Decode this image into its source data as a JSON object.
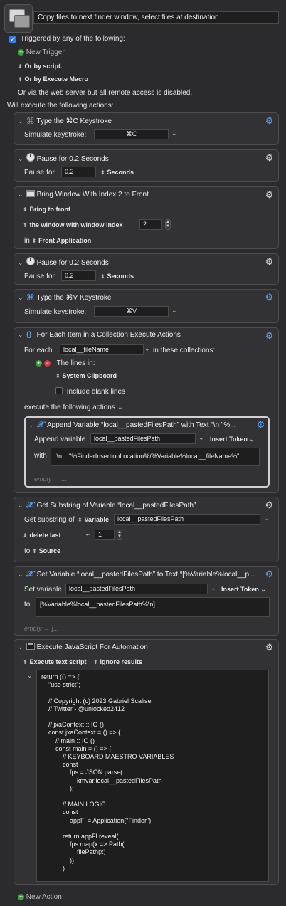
{
  "macro": {
    "name": "Copy files to next finder window, select files at destination"
  },
  "triggers": {
    "triggered_label": "Triggered by any of the following:",
    "new_trigger": "New Trigger",
    "or_by_script": "Or by script.",
    "or_by_execute_macro": "Or by Execute Macro",
    "web_server_note": "Or via the web server but all remote access is disabled.",
    "will_execute": "Will execute the following actions:"
  },
  "actions": [
    {
      "title": "Type the ⌘C Keystroke",
      "simulate_label": "Simulate keystroke:",
      "keystroke": "⌘C"
    },
    {
      "title": "Pause for 0.2 Seconds",
      "pause_label": "Pause for",
      "value": "0.2",
      "unit": "Seconds"
    },
    {
      "title": "Bring Window With Index 2 to Front",
      "mode": "Bring to front",
      "window_label": "the window with window index",
      "index": "2",
      "in_label": "in",
      "app": "Front Application"
    },
    {
      "title": "Pause for 0.2 Seconds",
      "pause_label": "Pause for",
      "value": "0.2",
      "unit": "Seconds"
    },
    {
      "title": "Type the ⌘V Keystroke",
      "simulate_label": "Simulate keystroke:",
      "keystroke": "⌘V"
    },
    {
      "title": "For Each Item in a Collection Execute Actions",
      "for_each_label": "For each",
      "variable": "local__fileName",
      "in_collections": "in these collections:",
      "lines_in": "The lines in:",
      "source": "System Clipboard",
      "include_blank": "Include blank lines",
      "execute_label": "execute the following actions",
      "sub_action": {
        "title": "Append Variable “local__pastedFilesPath” with Text “\\n    \"%...",
        "append_label": "Append variable",
        "variable": "local__pastedFilesPath",
        "insert_token": "Insert Token",
        "with_label": "with",
        "text": " \\n    \"%FinderInsertionLocation%/%Variable%local__fileName%\",",
        "empty": "empty → ..."
      }
    },
    {
      "title": "Get Substring of Variable “local__pastedFilesPath”",
      "get_label": "Get substring of",
      "var_kind": "Variable",
      "variable": "local__pastedFilesPath",
      "delete_label": "delete last",
      "arrow": "←",
      "count": "1",
      "to_label": "to",
      "dest": "Source"
    },
    {
      "title": "Set Variable “local__pastedFilesPath” to Text “[%Variable%local__p...",
      "set_label": "Set variable",
      "variable": "local__pastedFilesPath",
      "insert_token": "Insert Token",
      "to_label": "to",
      "text": "[%Variable%local__pastedFilesPath%\\n]",
      "empty": "empty → [..."
    },
    {
      "title": "Execute JavaScript For Automation",
      "mode": "Execute text script",
      "results": "Ignore results",
      "code": [
        "return (() => {",
        "    \"use strict\";",
        "",
        "    // Copyright (c) 2023 Gabriel Scalise",
        "    // Twitter - @unlocked2412",
        "",
        "    // jxaContext :: IO ()",
        "    const jxaContext = () => {",
        "        // main :: IO ()",
        "        const main = () => {",
        "            // KEYBOARD MAESTRO VARIABLES",
        "            const",
        "                fps = JSON.parse(",
        "                    kmvar.local__pastedFilesPath",
        "                );",
        "",
        "            // MAIN LOGIC",
        "            const",
        "                appFl = Application(\"Finder\");",
        "",
        "            return appFl.reveal(",
        "                fps.map(x => Path(",
        "                    filePath(x)",
        "                ))",
        "            )"
      ]
    }
  ],
  "footer": {
    "new_action": "New Action"
  }
}
